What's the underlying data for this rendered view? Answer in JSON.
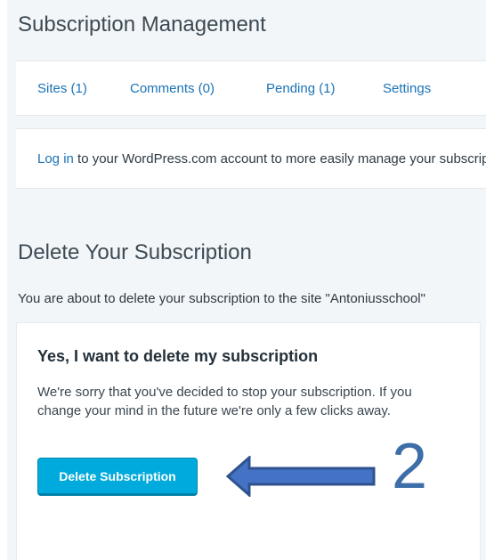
{
  "page": {
    "title": "Subscription Management"
  },
  "tabs": [
    {
      "label": "Sites (1)"
    },
    {
      "label": "Comments (0)"
    },
    {
      "label": "Pending (1)"
    },
    {
      "label": "Settings"
    }
  ],
  "login_notice": {
    "link_text": "Log in",
    "rest_text": " to your WordPress.com account to more easily manage your subscriptions."
  },
  "delete_section": {
    "title": "Delete Your Subscription",
    "about_text": "You are about to delete your subscription to the site \"Antoniusschool\"",
    "card": {
      "heading": "Yes, I want to delete my subscription",
      "body": "We're sorry that you've decided to stop your subscription. If you change your mind in the future we're only a few clicks away.",
      "button_label": "Delete Subscription"
    }
  },
  "annotation": {
    "arrow_icon": "left-arrow-icon",
    "step_number": "2",
    "color": "#3d6ea8"
  },
  "colors": {
    "accent": "#00aadc",
    "link": "#1a73b5",
    "background": "#f3f6f8"
  }
}
